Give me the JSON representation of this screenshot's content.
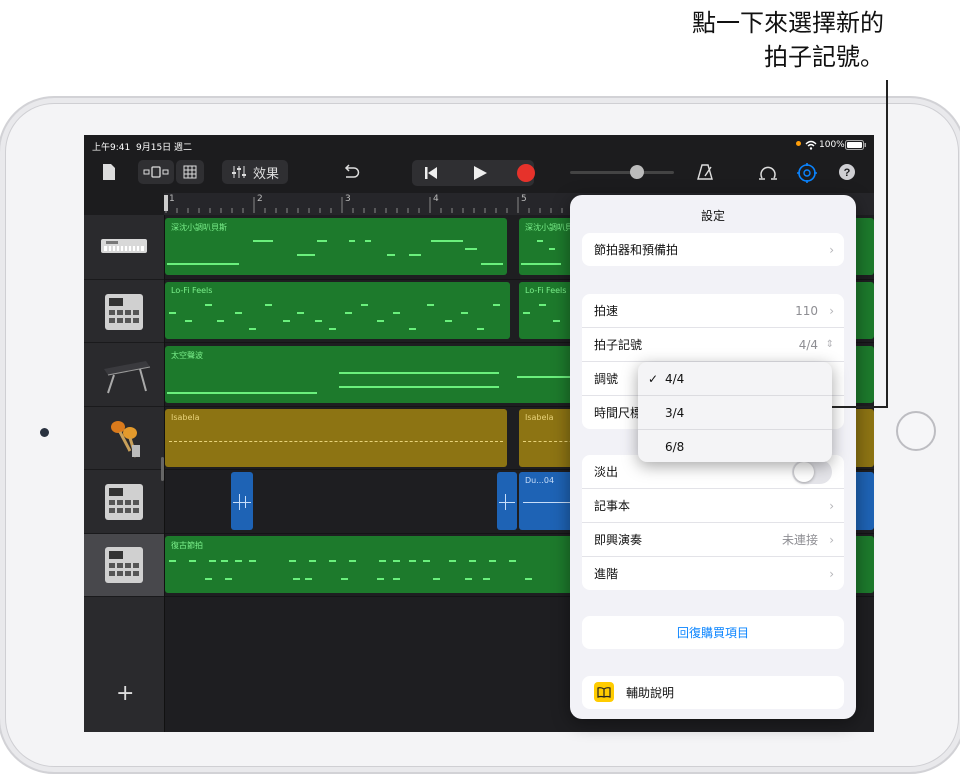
{
  "callout": {
    "line1": "點一下來選擇新的",
    "line2": "拍子記號。"
  },
  "status_bar": {
    "time": "上午9:41",
    "date": "9月15日 週二",
    "battery": "100%",
    "wifi_icon": "wifi-icon",
    "battery_icon": "battery-icon"
  },
  "toolbar": {
    "fx_label": "效果",
    "icons": [
      "document-icon",
      "view-toggle-icon",
      "grid-icon",
      "mixer-icon",
      "undo-icon",
      "go-to-start-icon",
      "play-icon",
      "record-icon",
      "metronome-icon",
      "loop-icon",
      "settings-icon",
      "help-icon"
    ],
    "record_color": "#e6322b",
    "accent_color": "#0a84ff"
  },
  "ruler": {
    "marks": [
      "1",
      "2",
      "3",
      "4",
      "5"
    ]
  },
  "tracks": [
    {
      "instrument_icon": "keyboard-instrument-icon",
      "regions": [
        "深沈小調叭貝斯",
        "深沈小調叭貝斯"
      ]
    },
    {
      "instrument_icon": "drum-machine-icon",
      "regions": [
        "Lo-Fi Feels",
        "Lo-Fi Feels"
      ]
    },
    {
      "instrument_icon": "synth-keyboard-icon",
      "regions": [
        "太空聲波"
      ]
    },
    {
      "instrument_icon": "shaker-icon",
      "regions": [
        "Isabela",
        "Isabela"
      ]
    },
    {
      "instrument_icon": "drum-machine-icon",
      "regions": [
        "Du...04"
      ]
    },
    {
      "instrument_icon": "drum-machine-icon",
      "regions": [
        "復古節拍"
      ]
    }
  ],
  "add_track_label": "+",
  "settings": {
    "title": "設定",
    "metronome": {
      "label": "節拍器和預備拍"
    },
    "tempo": {
      "label": "拍速",
      "value": "110"
    },
    "time_signature": {
      "label": "拍子記號",
      "value": "4/4"
    },
    "key": {
      "label": "調號"
    },
    "time_ruler": {
      "label": "時間尺標"
    },
    "fade_out": {
      "label": "淡出",
      "on": false
    },
    "notes": {
      "label": "記事本"
    },
    "jam": {
      "label": "即興演奏",
      "value": "未連接"
    },
    "advanced": {
      "label": "進階"
    },
    "restore": {
      "label": "回復購買項目"
    },
    "help": {
      "label": "輔助說明"
    }
  },
  "time_signature_menu": {
    "selected": "4/4",
    "options": [
      "4/4",
      "3/4",
      "6/8"
    ]
  }
}
